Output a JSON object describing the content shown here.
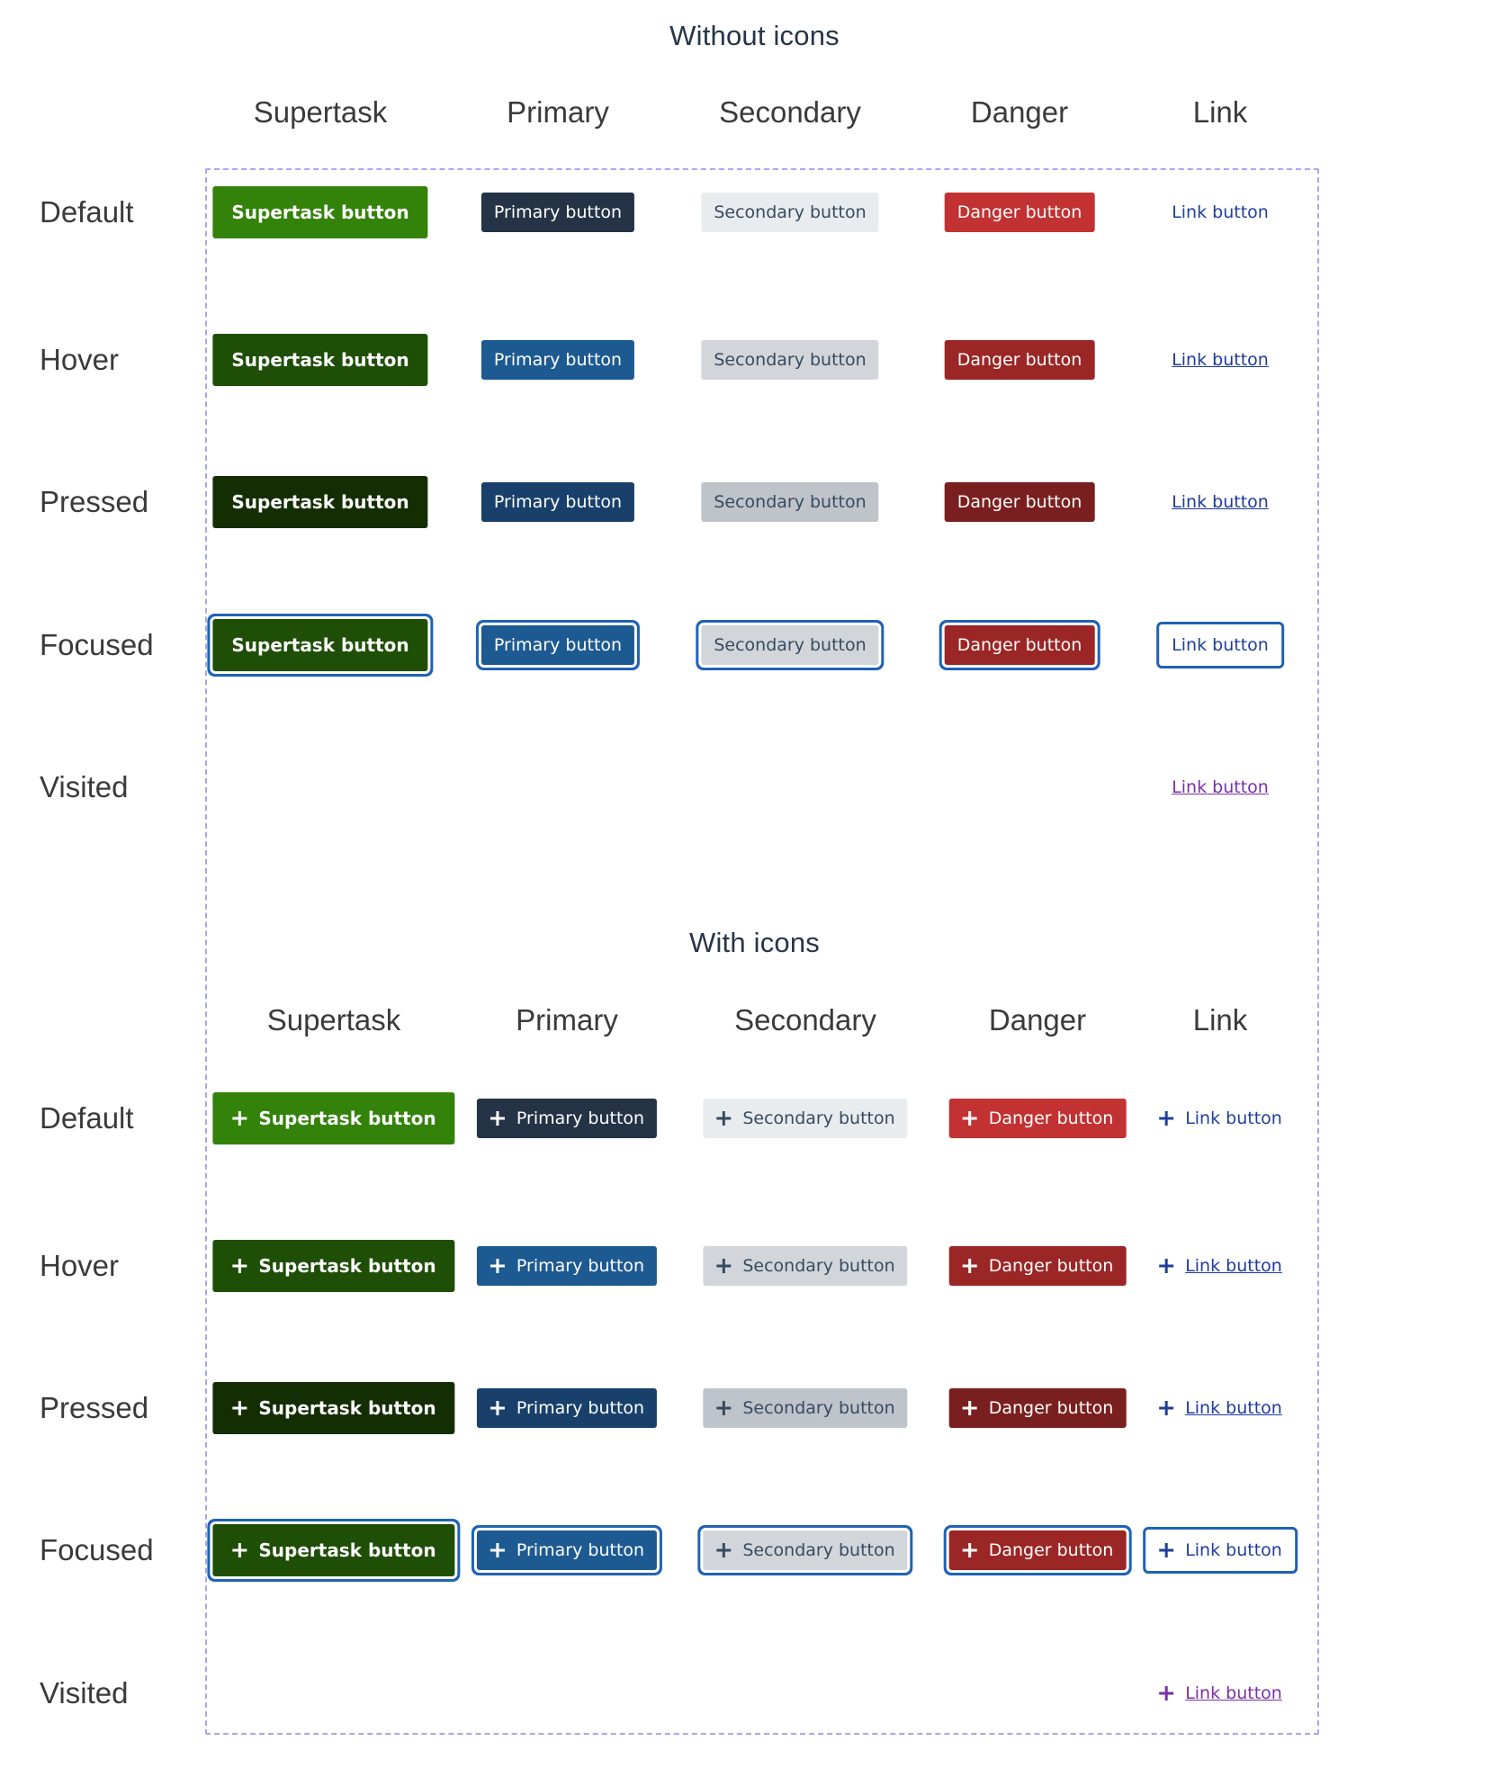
{
  "colors": {
    "frame_border": "#a9a6f0",
    "focus_ring": "#1f62b5",
    "supertask": "#338209",
    "primary": "#243346",
    "secondary": "#e9ecef",
    "danger": "#c23232",
    "link": "#1f3f9a",
    "visited": "#7b2fa8"
  },
  "section_without_icons": {
    "title": "Without icons",
    "columns": [
      "Supertask",
      "Primary",
      "Secondary",
      "Danger",
      "Link"
    ],
    "rows": [
      "Default",
      "Hover",
      "Pressed",
      "Focused",
      "Visited"
    ],
    "labels": {
      "supertask": "Supertask button",
      "primary": "Primary button",
      "secondary": "Secondary button",
      "danger": "Danger button",
      "link": "Link button"
    }
  },
  "section_with_icons": {
    "title": "With icons",
    "icon": "plus-icon",
    "columns": [
      "Supertask",
      "Primary",
      "Secondary",
      "Danger",
      "Link"
    ],
    "rows": [
      "Default",
      "Hover",
      "Pressed",
      "Focused",
      "Visited"
    ],
    "labels": {
      "supertask": "Supertask button",
      "primary": "Primary button",
      "secondary": "Secondary button",
      "danger": "Danger button",
      "link": "Link button"
    }
  }
}
